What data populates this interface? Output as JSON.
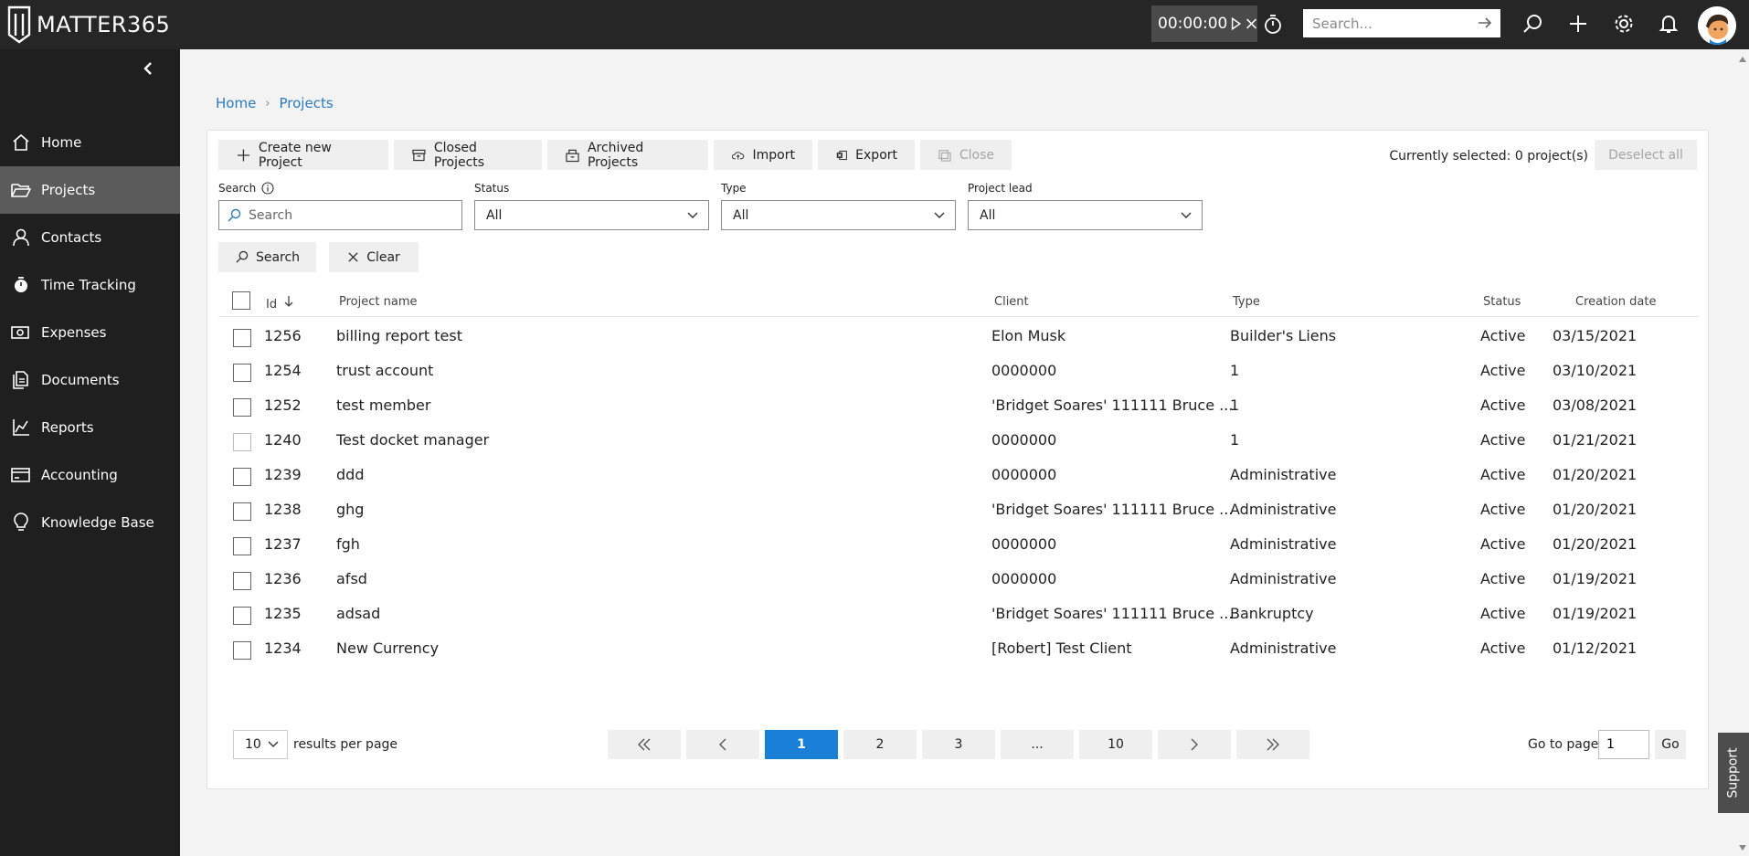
{
  "app": {
    "logo_text": "MATTER365"
  },
  "topbar": {
    "timer": "00:00:00",
    "search_placeholder": "Search...",
    "icons": [
      "play-icon",
      "close-icon",
      "stopwatch-icon",
      "search-icon",
      "plus-icon",
      "gear-icon",
      "bell-icon",
      "avatar"
    ]
  },
  "sidebar": {
    "items": [
      {
        "label": "Home",
        "icon": "home-icon"
      },
      {
        "label": "Projects",
        "icon": "folder-icon",
        "active": true
      },
      {
        "label": "Contacts",
        "icon": "person-icon"
      },
      {
        "label": "Time Tracking",
        "icon": "stopwatch-icon"
      },
      {
        "label": "Expenses",
        "icon": "money-icon"
      },
      {
        "label": "Documents",
        "icon": "documents-icon"
      },
      {
        "label": "Reports",
        "icon": "chart-icon"
      },
      {
        "label": "Accounting",
        "icon": "wallet-icon"
      },
      {
        "label": "Knowledge Base",
        "icon": "bulb-icon"
      }
    ]
  },
  "breadcrumb": {
    "home": "Home",
    "current": "Projects"
  },
  "toolbar": {
    "create": "Create new Project",
    "closed": "Closed Projects",
    "archived": "Archived Projects",
    "import": "Import",
    "export": "Export",
    "close": "Close",
    "selected_info": "Currently selected: 0 project(s)",
    "deselect": "Deselect all"
  },
  "filters": {
    "search_label": "Search",
    "search_placeholder": "Search",
    "status_label": "Status",
    "status_value": "All",
    "type_label": "Type",
    "type_value": "All",
    "lead_label": "Project lead",
    "lead_value": "All",
    "search_button": "Search",
    "clear_button": "Clear"
  },
  "table": {
    "headers": {
      "id": "Id",
      "name": "Project name",
      "client": "Client",
      "type": "Type",
      "status": "Status",
      "date": "Creation date"
    },
    "rows": [
      {
        "id": "1256",
        "name": "billing report test",
        "client": "Elon Musk",
        "type": "Builder's Liens",
        "status": "Active",
        "date": "03/15/2021"
      },
      {
        "id": "1254",
        "name": "trust account",
        "client": "0000000",
        "type": "1",
        "status": "Active",
        "date": "03/10/2021"
      },
      {
        "id": "1252",
        "name": "test member",
        "client": "'Bridget Soares' 111111 Bruce ...",
        "type": "1",
        "status": "Active",
        "date": "03/08/2021"
      },
      {
        "id": "1240",
        "name": "Test docket manager",
        "client": "0000000",
        "type": "1",
        "status": "Active",
        "date": "01/21/2021"
      },
      {
        "id": "1239",
        "name": "ddd",
        "client": "0000000",
        "type": "Administrative",
        "status": "Active",
        "date": "01/20/2021"
      },
      {
        "id": "1238",
        "name": "ghg",
        "client": "'Bridget Soares' 111111 Bruce ...",
        "type": "Administrative",
        "status": "Active",
        "date": "01/20/2021"
      },
      {
        "id": "1237",
        "name": "fgh",
        "client": "0000000",
        "type": "Administrative",
        "status": "Active",
        "date": "01/20/2021"
      },
      {
        "id": "1236",
        "name": "afsd",
        "client": "0000000",
        "type": "Administrative",
        "status": "Active",
        "date": "01/19/2021"
      },
      {
        "id": "1235",
        "name": "adsad",
        "client": "'Bridget Soares' 111111 Bruce ...",
        "type": "Bankruptcy",
        "status": "Active",
        "date": "01/19/2021"
      },
      {
        "id": "1234",
        "name": "New Currency",
        "client": "[Robert] Test Client",
        "type": "Administrative",
        "status": "Active",
        "date": "01/12/2021"
      }
    ]
  },
  "pagination": {
    "per_page": "10",
    "per_page_label": "results per page",
    "first": "«",
    "prev": "‹",
    "pages": [
      "1",
      "2",
      "3",
      "...",
      "10"
    ],
    "current_page": "1",
    "next": "›",
    "last": "»",
    "goto_label": "Go to page",
    "goto_value": "1",
    "go": "Go"
  },
  "support": "Support",
  "colors": {
    "accent": "#1a7fd6",
    "link": "#2b79c2",
    "topbar": "#262626",
    "sidebar": "#1f1f1f",
    "sidebar_active": "#5b5b5b"
  }
}
